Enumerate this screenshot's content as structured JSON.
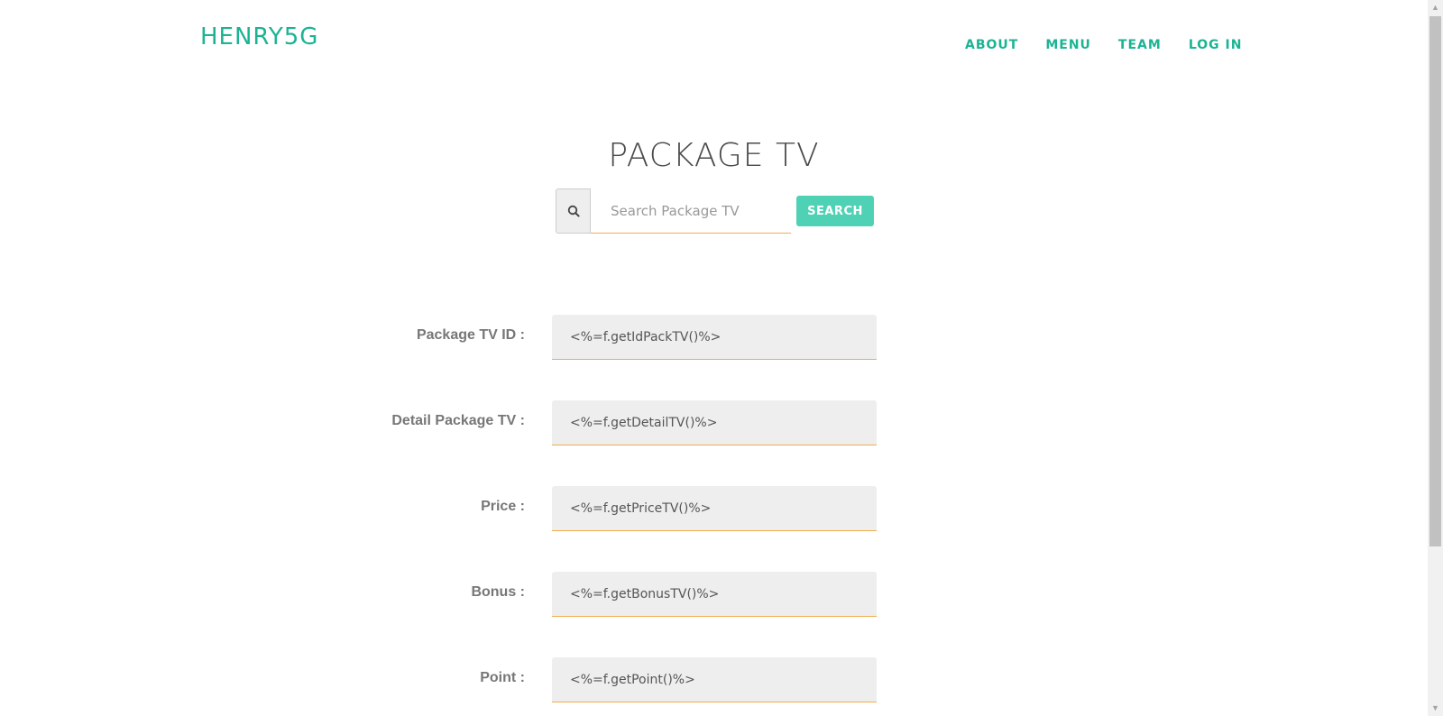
{
  "header": {
    "brand": "HENRY5G",
    "nav": [
      "ABOUT",
      "MENU",
      "TEAM",
      "LOG IN"
    ]
  },
  "page": {
    "title": "PACKAGE TV"
  },
  "search": {
    "icon": "search-icon",
    "placeholder": "Search Package TV",
    "button_label": "SEARCH"
  },
  "form": {
    "fields": [
      {
        "label": "Package TV ID :",
        "value": "<%=f.getIdPackTV()%>"
      },
      {
        "label": "Detail Package TV :",
        "value": "<%=f.getDetailTV()%>"
      },
      {
        "label": "Price :",
        "value": "<%=f.getPriceTV()%>"
      },
      {
        "label": "Bonus :",
        "value": "<%=f.getBonusTV()%>"
      },
      {
        "label": "Point :",
        "value": "<%=f.getPoint()%>"
      }
    ]
  },
  "colors": {
    "brand": "#1bb394",
    "button": "#4fd1b5",
    "field_bg": "#eeeeee",
    "underline": "#f0ad4e"
  }
}
